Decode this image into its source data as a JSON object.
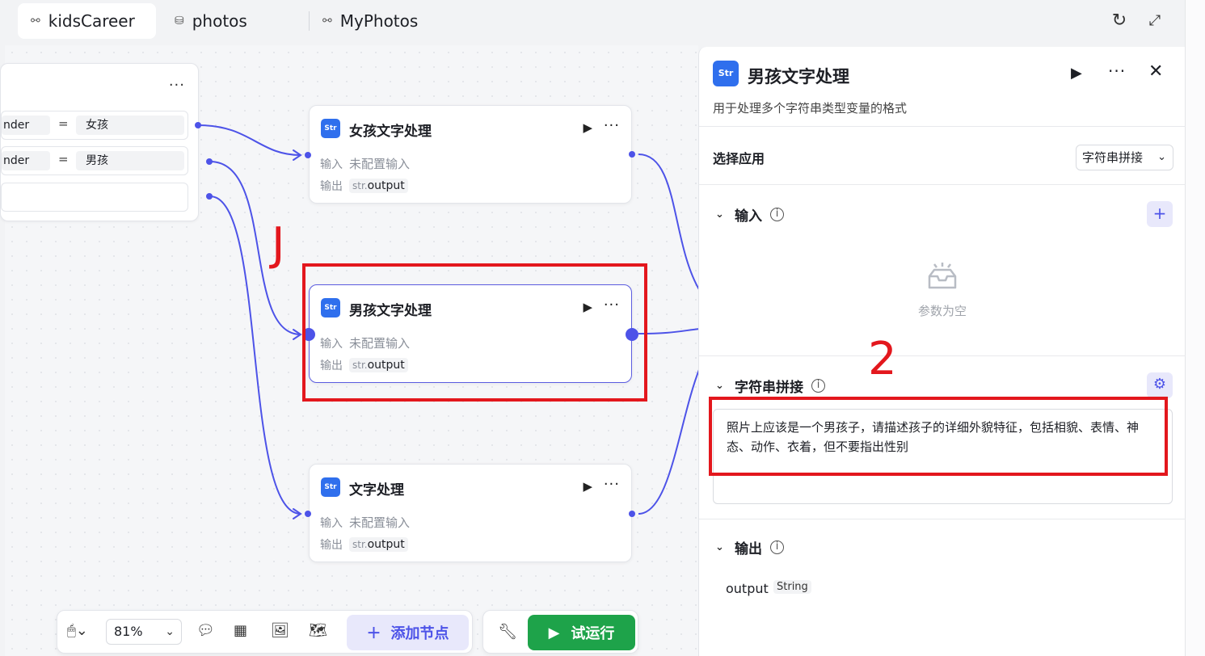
{
  "tabs": [
    {
      "label": "kidsCareer",
      "icon": "workflow-icon",
      "active": true
    },
    {
      "label": "photos",
      "icon": "database-icon",
      "active": false
    },
    {
      "label": "MyPhotos",
      "icon": "workflow-icon",
      "active": false
    }
  ],
  "condition_node": {
    "rows": [
      {
        "left": "nder",
        "op": "=",
        "right": "女孩"
      },
      {
        "left": "nder",
        "op": "=",
        "right": "男孩"
      },
      {
        "left": "",
        "op": "",
        "right": ""
      }
    ]
  },
  "nodes": [
    {
      "title": "女孩文字处理",
      "input_label": "输入",
      "input_value": "未配置输入",
      "output_label": "输出",
      "output_prefix": "str.",
      "output_value": "output"
    },
    {
      "title": "男孩文字处理",
      "input_label": "输入",
      "input_value": "未配置输入",
      "output_label": "输出",
      "output_prefix": "str.",
      "output_value": "output"
    },
    {
      "title": "文字处理",
      "input_label": "输入",
      "input_value": "未配置输入",
      "output_label": "输出",
      "output_prefix": "str.",
      "output_value": "output"
    }
  ],
  "node_icon_text": "Str",
  "annotations": {
    "mark1": "J",
    "mark2": "2"
  },
  "toolbar": {
    "zoom": "81%",
    "add_node_label": "添加节点",
    "run_label": "试运行"
  },
  "panel": {
    "title": "男孩文字处理",
    "description": "用于处理多个字符串类型变量的格式",
    "select_app_label": "选择应用",
    "selected_app": "字符串拼接",
    "input_section": "输入",
    "empty_text": "参数为空",
    "concat_section": "字符串拼接",
    "concat_text": "照片上应该是一个男孩子，请描述孩子的详细外貌特征，包括相貌、表情、神态、动作、衣着，但不要指出性别",
    "output_section": "输出",
    "output_name": "output",
    "output_type": "String"
  },
  "colors": {
    "accent": "#4d53e8",
    "run_green": "#1ea34a",
    "annotation_red": "#e3171d",
    "node_icon_blue": "#2f6fed"
  }
}
